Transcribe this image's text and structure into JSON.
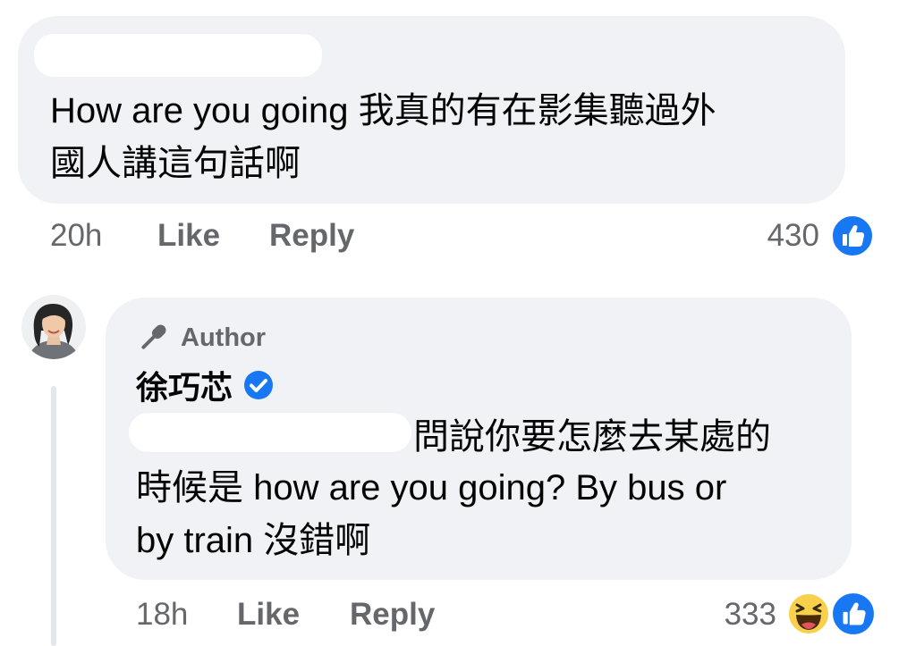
{
  "comment1": {
    "text": "How are you going 我真的有在影集聽過外\n國人講這句話啊",
    "time": "20h",
    "like_label": "Like",
    "reply_label": "Reply",
    "reaction_count": "430",
    "reactions": [
      "like-icon"
    ]
  },
  "comment2": {
    "badge": "Author",
    "author": "徐巧芯",
    "verified": true,
    "text_line1": "問說你要怎麼去某處的",
    "text_rest": "時候是 how are you going? By bus or\nby train 沒錯啊",
    "time": "18h",
    "like_label": "Like",
    "reply_label": "Reply",
    "reaction_count": "333",
    "reactions": [
      "haha-icon",
      "like-icon"
    ]
  },
  "colors": {
    "bubble": "#f0f2f5",
    "meta_text": "#65676b",
    "like_blue": "#1877f2",
    "haha_yellow": "#f7d14b",
    "thread_line": "#e4e6eb"
  }
}
